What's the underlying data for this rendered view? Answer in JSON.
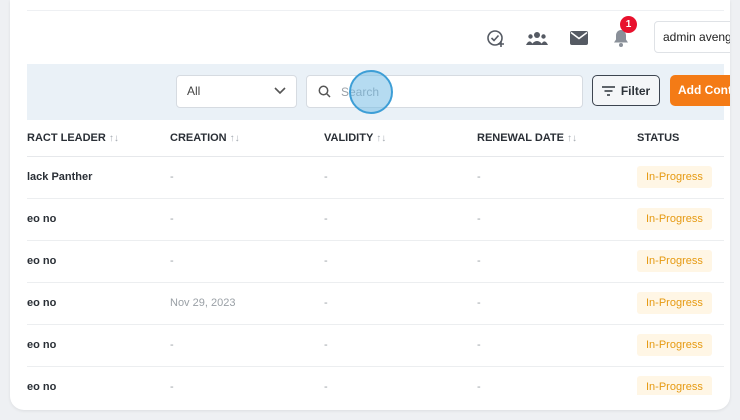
{
  "header": {
    "user_name": "admin avengers",
    "notification_count": "1",
    "icons": [
      "check-add-icon",
      "team-icon",
      "mail-icon",
      "bell-icon"
    ]
  },
  "toolbar": {
    "status_select": "All",
    "search_placeholder": "Search",
    "filter_label": "Filter",
    "add_label": "Add Contract"
  },
  "table": {
    "columns": [
      {
        "label": "RACT LEADER",
        "sortable": true
      },
      {
        "label": "CREATION",
        "sortable": true
      },
      {
        "label": "VALIDITY",
        "sortable": true
      },
      {
        "label": "RENEWAL DATE",
        "sortable": true
      },
      {
        "label": "STATUS",
        "sortable": false
      }
    ],
    "sort_glyph": "↑↓",
    "rows": [
      {
        "leader": "lack Panther",
        "creation": "-",
        "validity": "-",
        "renewal": "-",
        "status": "In-Progress"
      },
      {
        "leader": "eo no",
        "creation": "-",
        "validity": "-",
        "renewal": "-",
        "status": "In-Progress"
      },
      {
        "leader": "eo no",
        "creation": "-",
        "validity": "-",
        "renewal": "-",
        "status": "In-Progress"
      },
      {
        "leader": "eo no",
        "creation": "Nov 29, 2023",
        "validity": "-",
        "renewal": "-",
        "status": "In-Progress"
      },
      {
        "leader": "eo no",
        "creation": "-",
        "validity": "-",
        "renewal": "-",
        "status": "In-Progress"
      },
      {
        "leader": "eo no",
        "creation": "-",
        "validity": "-",
        "renewal": "-",
        "status": "In-Progress"
      }
    ]
  },
  "colors": {
    "accent": "#f47b16",
    "status_bg": "#fff6e5",
    "status_text": "#e69a12",
    "badge": "#e8112d"
  }
}
